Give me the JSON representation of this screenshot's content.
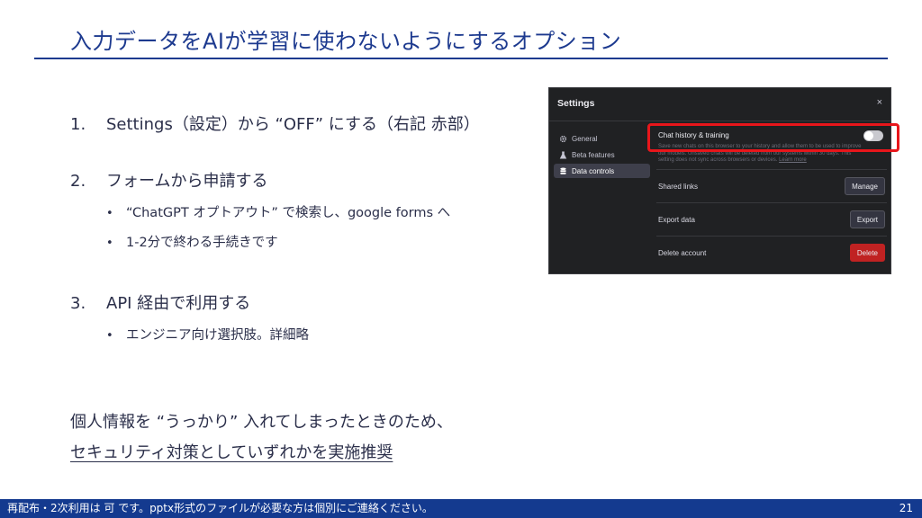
{
  "slide": {
    "title": "入力データをAIが学習に使わないようにするオプション",
    "items": [
      {
        "num": "1.",
        "text": "Settings（設定）から “OFF” にする（右記 赤部）",
        "bullets": []
      },
      {
        "num": "2.",
        "text": "フォームから申請する",
        "bullets": [
          "“ChatGPT オプトアウト” で検索し、google forms へ",
          "1-2分で終わる手続きです"
        ]
      },
      {
        "num": "3.",
        "text": "API 経由で利用する",
        "bullets": [
          "エンジニア向け選択肢。詳細略"
        ]
      }
    ],
    "summary_line1": "個人情報を “うっかり” 入れてしまったときのため、",
    "summary_line2": "セキュリティ対策としていずれかを実施推奨"
  },
  "footer": {
    "note": "再配布・2次利用は 可 です。pptx形式のファイルが必要な方は個別にご連絡ください。",
    "page": "21"
  },
  "settings": {
    "title": "Settings",
    "close": "×",
    "sidebar": [
      {
        "label": "General",
        "icon": "gear-icon",
        "active": false
      },
      {
        "label": "Beta features",
        "icon": "flask-icon",
        "active": false
      },
      {
        "label": "Data controls",
        "icon": "database-icon",
        "active": true
      }
    ],
    "chat_history": {
      "label": "Chat history & training",
      "description": "Save new chats on this browser to your history and allow them to be used to improve our models. Unsaved chats will be deleted from our systems within 30 days. This setting does not sync across browsers or devices.",
      "learn_more": "Learn more",
      "toggle_on": false
    },
    "rows": [
      {
        "label": "Shared links",
        "button": "Manage"
      },
      {
        "label": "Export data",
        "button": "Export"
      },
      {
        "label": "Delete account",
        "button": "Delete"
      }
    ]
  },
  "colors": {
    "accent": "#1d3a8f",
    "footer": "#143a8f",
    "highlight": "#e8161b",
    "danger": "#c02222"
  }
}
